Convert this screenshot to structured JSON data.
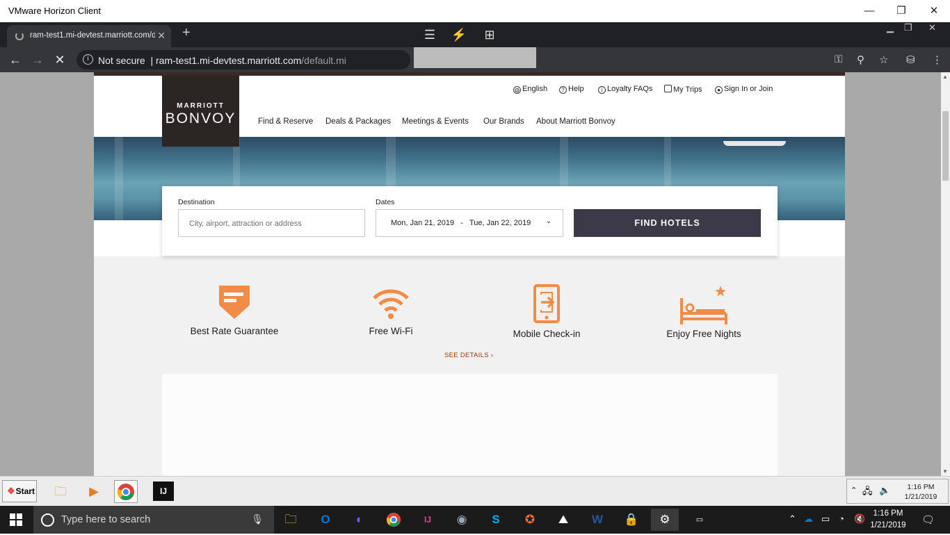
{
  "vm": {
    "title": "VMware Horizon Client"
  },
  "browser": {
    "tab_title": "ram-test1.mi-devtest.marriott.com/d",
    "security": "Not secure",
    "url_host": "ram-test1.mi-devtest.marriott.com",
    "url_path": "/default.mi"
  },
  "site": {
    "logo_top": "MARRIOTT",
    "logo_main": "BONVOY",
    "utility": [
      {
        "label": "English",
        "icon": "globe-icon"
      },
      {
        "label": "Help",
        "icon": "help-icon"
      },
      {
        "label": "Loyalty FAQs",
        "icon": "info-icon"
      },
      {
        "label": "My Trips",
        "icon": "suitcase-icon"
      },
      {
        "label": "Sign In or Join",
        "icon": "user-icon"
      }
    ],
    "nav": [
      "Find & Reserve",
      "Deals & Packages",
      "Meetings & Events",
      "Our Brands",
      "About Marriott Bonvoy"
    ],
    "search": {
      "destination_label": "Destination",
      "destination_placeholder": "City, airport, attraction or address",
      "dates_label": "Dates",
      "dates_value": "Mon, Jan 21, 2019   -   Tue, Jan 22, 2019",
      "button": "FIND HOTELS"
    },
    "features": [
      {
        "label": "Best Rate Guarantee",
        "icon": "rate-tag-icon"
      },
      {
        "label": "Free Wi-Fi",
        "icon": "wifi-icon"
      },
      {
        "label": "Mobile Check-in",
        "icon": "mobile-checkin-icon"
      },
      {
        "label": "Enjoy Free Nights",
        "icon": "bed-icon"
      }
    ],
    "see_details": "SEE DETAILS ›",
    "accent": "#f28b46"
  },
  "xp_taskbar": {
    "start": "Start",
    "time": "1:16 PM",
    "date": "1/21/2019"
  },
  "win10": {
    "search_placeholder": "Type here to search",
    "time": "1:16 PM",
    "date": "1/21/2019"
  }
}
